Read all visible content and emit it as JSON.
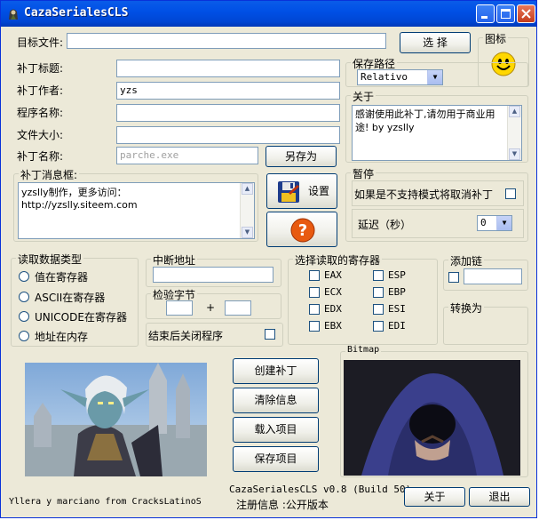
{
  "window": {
    "title": "CazaSerialesCLS"
  },
  "top": {
    "target_file_label": "目标文件:",
    "target_file_value": "",
    "browse_button": "选 择",
    "icon_group_title": "图标"
  },
  "patch": {
    "title_label": "补丁标题:",
    "title_value": "",
    "author_label": "补丁作者:",
    "author_value": "yzs",
    "program_label": "程序名称:",
    "program_value": "",
    "size_label": "文件大小:",
    "size_value": "",
    "name_label": "补丁名称:",
    "name_placeholder": "parche.exe",
    "save_as_button": "另存为"
  },
  "save_path": {
    "title": "保存路径",
    "selected": "Relativo"
  },
  "about": {
    "title": "关于",
    "text": "感谢使用此补丁,请勿用于商业用途!       by  yzslly"
  },
  "message": {
    "title": "补丁消息框:",
    "text": "yzslly制作，更多访问：http://yzslly.siteem.com"
  },
  "actions": {
    "settings_button": "设置"
  },
  "pause": {
    "title": "暂停",
    "unsupported_label": "如果是不支持模式将取消补丁",
    "delay_label": "延迟（秒）",
    "delay_value": "0"
  },
  "read_type": {
    "title": "读取数据类型",
    "options": [
      "值在寄存器",
      "ASCII在寄存器",
      "UNICODE在寄存器",
      "地址在内存"
    ]
  },
  "break_addr": {
    "title": "中断地址",
    "value": ""
  },
  "check_bytes": {
    "title": "检验字节",
    "a": "",
    "plus": "+",
    "b": ""
  },
  "close_after": {
    "label": "结束后关闭程序"
  },
  "registers": {
    "title": "选择读取的寄存器",
    "left": [
      "EAX",
      "ECX",
      "EDX",
      "EBX"
    ],
    "right": [
      "ESP",
      "EBP",
      "ESI",
      "EDI"
    ]
  },
  "add_chain": {
    "title": "添加链",
    "value": ""
  },
  "convert": {
    "title": "转换为"
  },
  "buttons": {
    "create": "创建补丁",
    "clear": "清除信息",
    "load": "载入项目",
    "save": "保存项目",
    "about": "关于",
    "exit": "退出"
  },
  "bitmap": {
    "title": "Bitmap"
  },
  "footer": {
    "credits": "Yllera y marciano from CracksLatinoS",
    "version": "CazaSerialesCLS v0.8 (Build 50)",
    "reg_info": "注册信息 :公开版本"
  },
  "colors": {
    "titlebar": "#0054e3",
    "face": "#ece9d8"
  }
}
